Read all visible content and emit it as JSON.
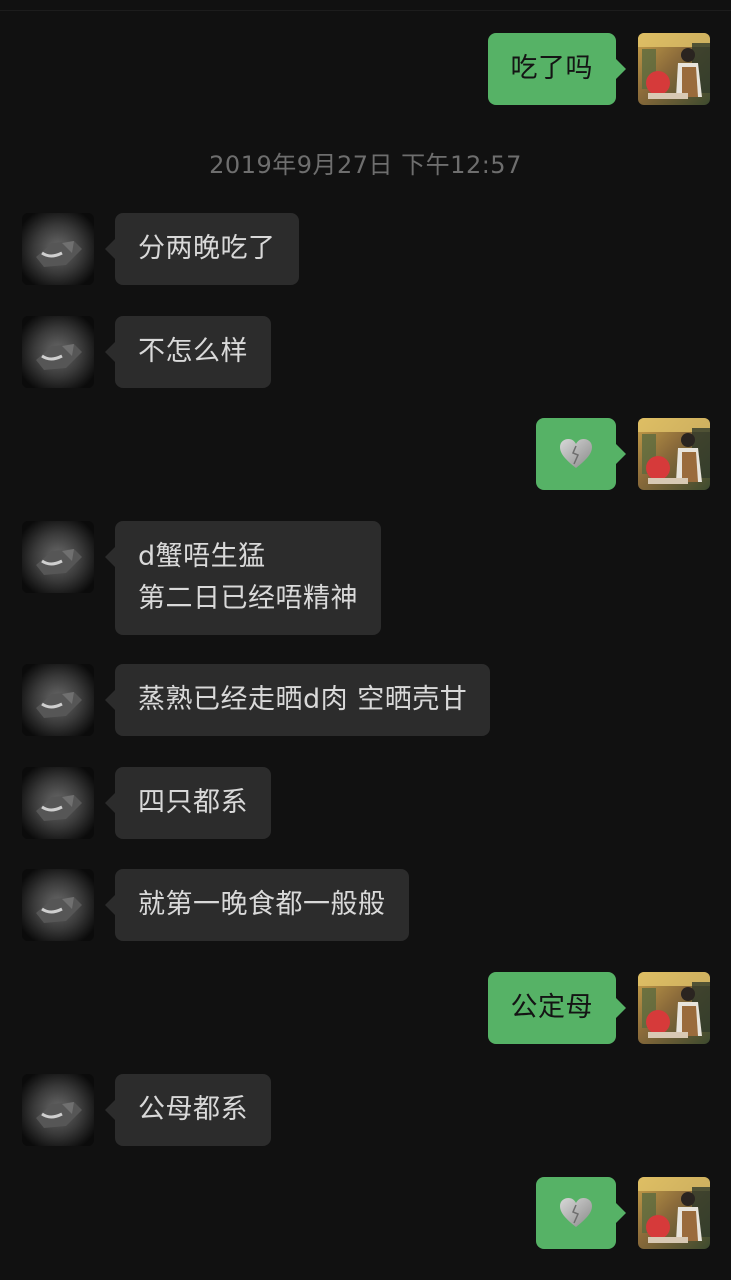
{
  "chat": {
    "timestamp": "2019年9月27日 下午12:57",
    "messages": [
      {
        "id": "m1",
        "sender": "me",
        "type": "text",
        "text": "吃了吗"
      },
      {
        "id": "m2",
        "sender": "contact",
        "type": "text",
        "text": "分两晚吃了"
      },
      {
        "id": "m3",
        "sender": "contact",
        "type": "text",
        "text": "不怎么样"
      },
      {
        "id": "m4",
        "sender": "me",
        "type": "emoji",
        "emoji": "grey-heart-icon"
      },
      {
        "id": "m5",
        "sender": "contact",
        "type": "text",
        "text": "d蟹唔生猛\n第二日已经唔精神"
      },
      {
        "id": "m6",
        "sender": "contact",
        "type": "text",
        "text": "蒸熟已经走晒d肉 空晒壳甘"
      },
      {
        "id": "m7",
        "sender": "contact",
        "type": "text",
        "text": "四只都系"
      },
      {
        "id": "m8",
        "sender": "contact",
        "type": "text",
        "text": "就第一晚食都一般般"
      },
      {
        "id": "m9",
        "sender": "me",
        "type": "text",
        "text": "公定母"
      },
      {
        "id": "m10",
        "sender": "contact",
        "type": "text",
        "text": "公母都系"
      },
      {
        "id": "m11",
        "sender": "me",
        "type": "emoji",
        "emoji": "grey-heart-icon"
      }
    ]
  },
  "colors": {
    "background": "#111111",
    "outgoing_bubble": "#56b266",
    "incoming_bubble": "#2c2c2c",
    "timestamp_text": "#6e6e6e"
  }
}
